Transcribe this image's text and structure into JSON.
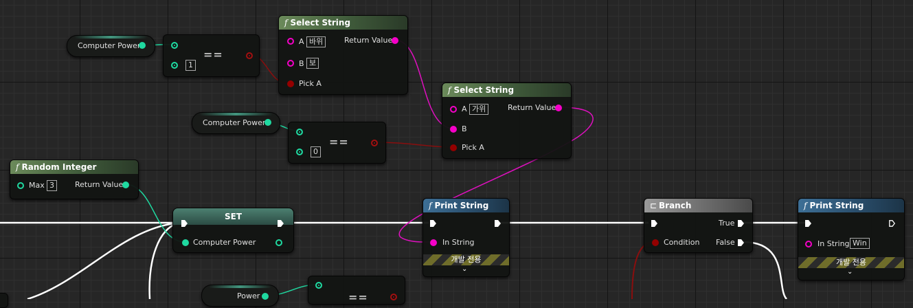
{
  "nodes": {
    "select_string_1": {
      "title": "Select String",
      "pin_a_label": "A",
      "pin_a_value": "바위",
      "pin_b_label": "B",
      "pin_b_value": "보",
      "pick_a_label": "Pick A",
      "return_label": "Return Value"
    },
    "select_string_2": {
      "title": "Select String",
      "pin_a_label": "A",
      "pin_a_value": "가위",
      "pin_b_label": "B",
      "pick_a_label": "Pick A",
      "return_label": "Return Value"
    },
    "equal_1": {
      "symbol": "==",
      "value": "1"
    },
    "equal_2": {
      "symbol": "==",
      "value": "0"
    },
    "equal_3": {
      "symbol": "=="
    },
    "get_computer_power_1": {
      "label": "Computer Power"
    },
    "get_computer_power_2": {
      "label": "Computer Power"
    },
    "get_power": {
      "label": "Power"
    },
    "random_integer": {
      "title": "Random Integer",
      "max_label": "Max",
      "max_value": "3",
      "return_label": "Return Value"
    },
    "set_node": {
      "title": "SET",
      "pin_label": "Computer Power"
    },
    "print_string_1": {
      "title": "Print String",
      "in_string_label": "In String",
      "dev_only": "개발 전용"
    },
    "branch": {
      "title": "Branch",
      "condition_label": "Condition",
      "true_label": "True",
      "false_label": "False"
    },
    "print_string_2": {
      "title": "Print String",
      "in_string_label": "In String",
      "in_string_value": "Win",
      "dev_only": "개발 전용"
    }
  },
  "icons": {
    "function": "function-icon",
    "branch": "branch-icon",
    "expand": "chevron-down-icon"
  },
  "colors": {
    "exec": "#ffffff",
    "integer": "#1fd9a0",
    "string": "#f500c8",
    "boolean": "#940000",
    "function_header": "#4d6b45",
    "print_header": "#2f5a7a",
    "branch_header": "#7a7a7a"
  }
}
